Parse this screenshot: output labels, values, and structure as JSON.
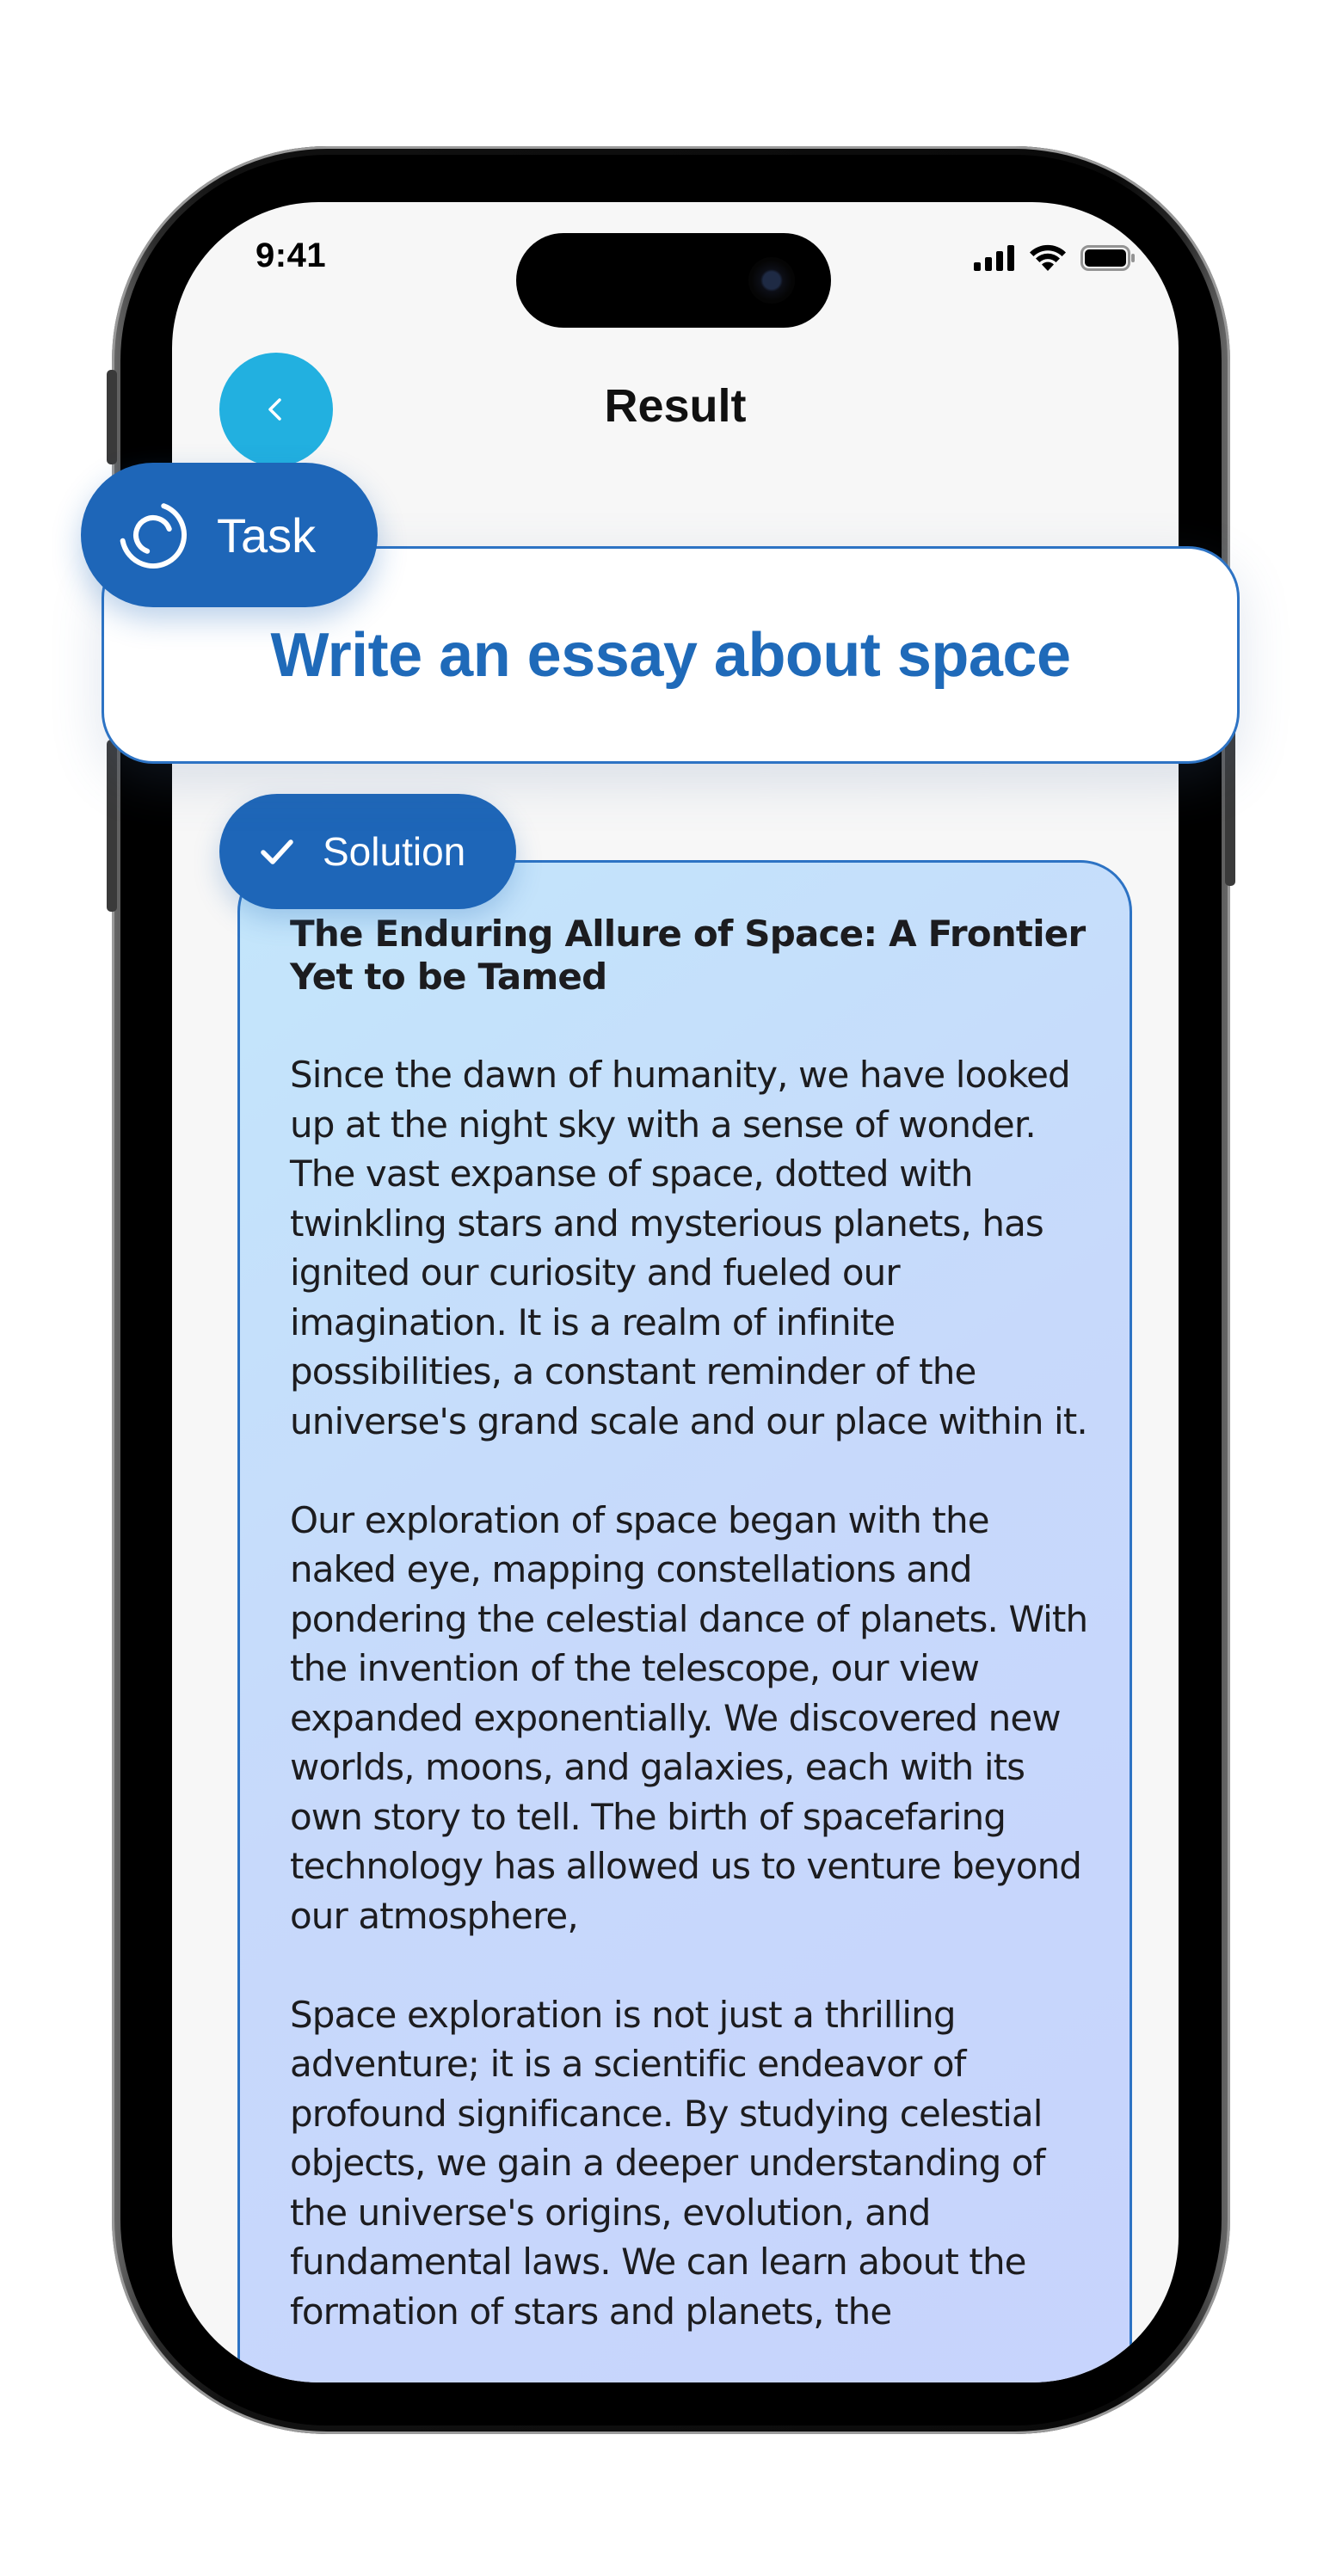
{
  "status_bar": {
    "time": "9:41"
  },
  "nav": {
    "title": "Result"
  },
  "task": {
    "label": "Task",
    "text": "Write an essay about space"
  },
  "solution": {
    "label": "Solution",
    "essay_title": "The Enduring Allure of Space: A Frontier Yet to be Tamed",
    "paragraphs": [
      "Since the dawn of humanity, we have looked up at the night sky with a sense of wonder. The vast expanse of space, dotted with twinkling stars and mysterious planets, has ignited our curiosity and fueled our imagination. It is a realm of infinite possibilities, a constant reminder of the universe's grand scale and our place within it.",
      "Our exploration of space began with the naked eye, mapping constellations and pondering the celestial dance of planets. With the invention of the telescope, our view expanded exponentially. We discovered new worlds, moons, and galaxies, each with its own story to tell. The birth of spacefaring technology has allowed us to venture beyond our atmosphere,",
      "Space exploration is not just a thrilling adventure; it is a scientific endeavor of profound significance. By studying celestial objects, we gain a deeper understanding of the universe's origins, evolution, and fundamental laws. We can learn about the formation of stars and planets, the"
    ]
  },
  "colors": {
    "accent_blue": "#1e66b8",
    "back_button": "#22b0e0",
    "task_text": "#1f6ab9"
  },
  "icons": {
    "back": "chevron-left-icon",
    "task": "spinner-icon",
    "solution": "checkmark-icon",
    "signal": "cellular-signal-icon",
    "wifi": "wifi-icon",
    "battery": "battery-icon"
  }
}
